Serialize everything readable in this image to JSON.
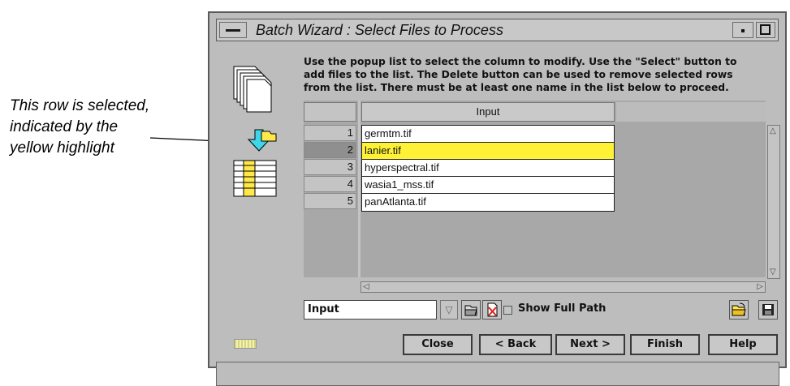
{
  "annotation": {
    "lines": [
      "This row is selected,",
      "indicated by the",
      "yellow highlight"
    ]
  },
  "window": {
    "title": "Batch Wizard : Select Files to Process",
    "instructions": "Use the popup list to select the column to modify. Use the \"Select\" button to\nadd files to the list. The Delete button can be used to remove selected rows\nfrom the list. There must be at least one name in the list below to proceed."
  },
  "table": {
    "column_header": "Input",
    "rows": [
      {
        "num": "1",
        "file": "germtm.tif",
        "selected": false
      },
      {
        "num": "2",
        "file": "lanier.tif",
        "selected": true
      },
      {
        "num": "3",
        "file": "hyperspectral.tif",
        "selected": false
      },
      {
        "num": "4",
        "file": "wasia1_mss.tif",
        "selected": false
      },
      {
        "num": "5",
        "file": "panAtlanta.tif",
        "selected": false
      }
    ]
  },
  "controls": {
    "column_select_value": "Input",
    "show_full_path_label": "Show Full Path",
    "show_full_path_checked": false
  },
  "buttons": {
    "close": "Close",
    "back": "< Back",
    "next": "Next >",
    "finish": "Finish",
    "help": "Help"
  },
  "colors": {
    "selection_highlight": "#fff236",
    "window_bg": "#bdbdbd"
  }
}
